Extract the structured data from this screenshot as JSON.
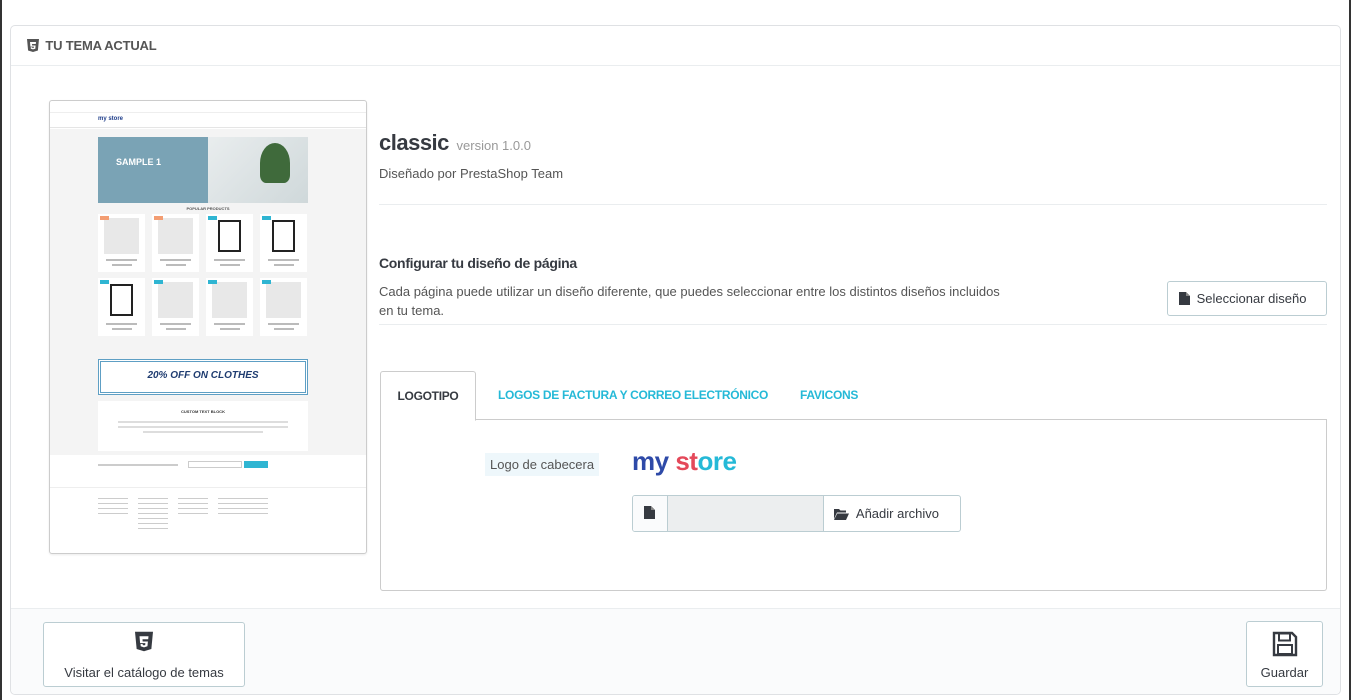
{
  "panel": {
    "title": "TU TEMA ACTUAL",
    "icon": "html5-icon"
  },
  "theme": {
    "name": "classic",
    "version": "version 1.0.0",
    "author": "Diseñado por PrestaShop Team"
  },
  "layout_config": {
    "title": "Configurar tu diseño de página",
    "description": "Cada página puede utilizar un diseño diferente, que puedes seleccionar entre los distintos diseños incluidos en tu tema.",
    "select_button": "Seleccionar diseño",
    "select_icon": "file-icon"
  },
  "tabs": [
    {
      "label": "LOGOTIPO",
      "active": true
    },
    {
      "label": "LOGOS DE FACTURA Y CORREO ELECTRÓNICO",
      "active": false
    },
    {
      "label": "FAVICONS",
      "active": false
    }
  ],
  "logo_tab": {
    "label": "Logo de cabecera",
    "logo_text_my": "my",
    "logo_text_store_1": "st",
    "logo_text_store_2": "ore",
    "file_input_value": "",
    "add_file_button": "Añadir archivo",
    "file_icon": "file-icon",
    "folder_icon": "folder-open-icon"
  },
  "preview": {
    "logo": "my store",
    "hero_text": "SAMPLE 1",
    "section_title": "POPULAR PRODUCTS",
    "banner_text": "20% OFF ON CLOTHES",
    "custom_block_title": "CUSTOM TEXT BLOCK"
  },
  "footer": {
    "catalog_button": "Visitar el catálogo de temas",
    "catalog_icon": "html5-icon",
    "save_button": "Guardar",
    "save_icon": "save-icon"
  },
  "colors": {
    "accent": "#25b9d7",
    "text": "#363a41",
    "border": "#bbcdd2",
    "logo_blue": "#2e4aa8",
    "logo_red": "#e4495a"
  }
}
